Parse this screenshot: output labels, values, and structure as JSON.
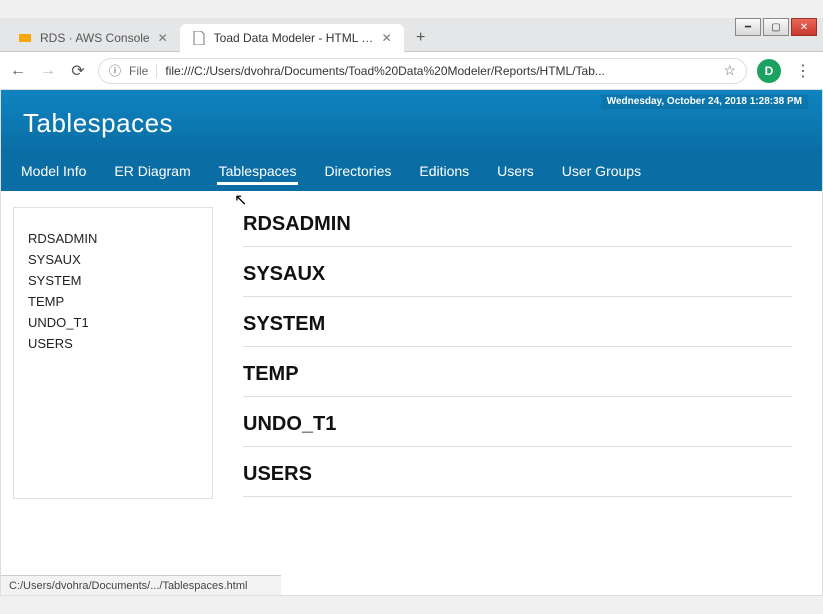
{
  "window": {
    "tabs": [
      {
        "title": "RDS · AWS Console",
        "favicon": "aws",
        "active": false
      },
      {
        "title": "Toad Data Modeler - HTML Repo",
        "favicon": "file",
        "active": true
      }
    ]
  },
  "toolbar": {
    "url_type": "File",
    "url": "file:///C:/Users/dvohra/Documents/Toad%20Data%20Modeler/Reports/HTML/Tab...",
    "info_icon": "ⓘ",
    "profile_letter": "D"
  },
  "page": {
    "timestamp": "Wednesday, October 24, 2018 1:28:38 PM",
    "title": "Tablespaces",
    "nav": [
      {
        "label": "Model Info",
        "active": false
      },
      {
        "label": "ER Diagram",
        "active": false
      },
      {
        "label": "Tablespaces",
        "active": true
      },
      {
        "label": "Directories",
        "active": false
      },
      {
        "label": "Editions",
        "active": false
      },
      {
        "label": "Users",
        "active": false
      },
      {
        "label": "User Groups",
        "active": false
      }
    ],
    "sidebar_items": [
      "RDSADMIN",
      "SYSAUX",
      "SYSTEM",
      "TEMP",
      "UNDO_T1",
      "USERS"
    ],
    "main_items": [
      "RDSADMIN",
      "SYSAUX",
      "SYSTEM",
      "TEMP",
      "UNDO_T1",
      "USERS"
    ]
  },
  "status_bar": "C:/Users/dvohra/Documents/.../Tablespaces.html"
}
